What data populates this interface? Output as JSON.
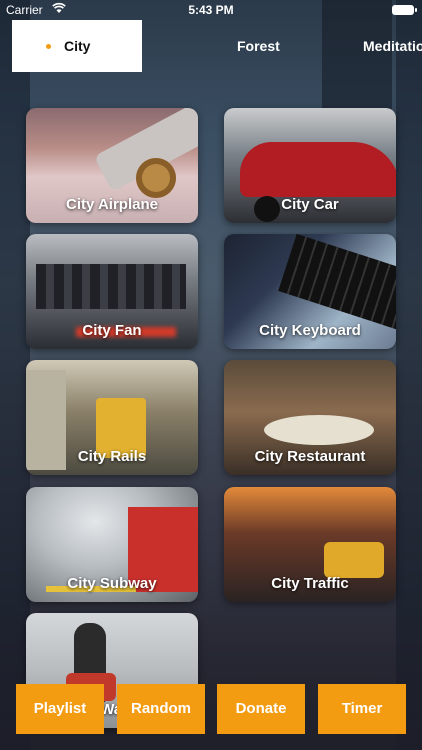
{
  "status": {
    "carrier": "Carrier",
    "time": "5:43 PM"
  },
  "tabs": [
    {
      "label": "City",
      "selected": true
    },
    {
      "label": "Forest",
      "selected": false
    },
    {
      "label": "Meditatio",
      "selected": false
    }
  ],
  "sounds": [
    {
      "label": "City Airplane"
    },
    {
      "label": "City Car"
    },
    {
      "label": "City Fan"
    },
    {
      "label": "City Keyboard"
    },
    {
      "label": "City Rails"
    },
    {
      "label": "City Restaurant"
    },
    {
      "label": "City Subway"
    },
    {
      "label": "City Traffic"
    },
    {
      "label": "City Wa... ch"
    }
  ],
  "bottom_bar": {
    "playlist": "Playlist",
    "random": "Random",
    "donate": "Donate",
    "timer": "Timer"
  },
  "colors": {
    "accent": "#f39c12",
    "active_tab_bg": "#ffffff",
    "indicator": "#f39c12"
  },
  "icons": [
    "wifi-icon",
    "battery-icon"
  ]
}
